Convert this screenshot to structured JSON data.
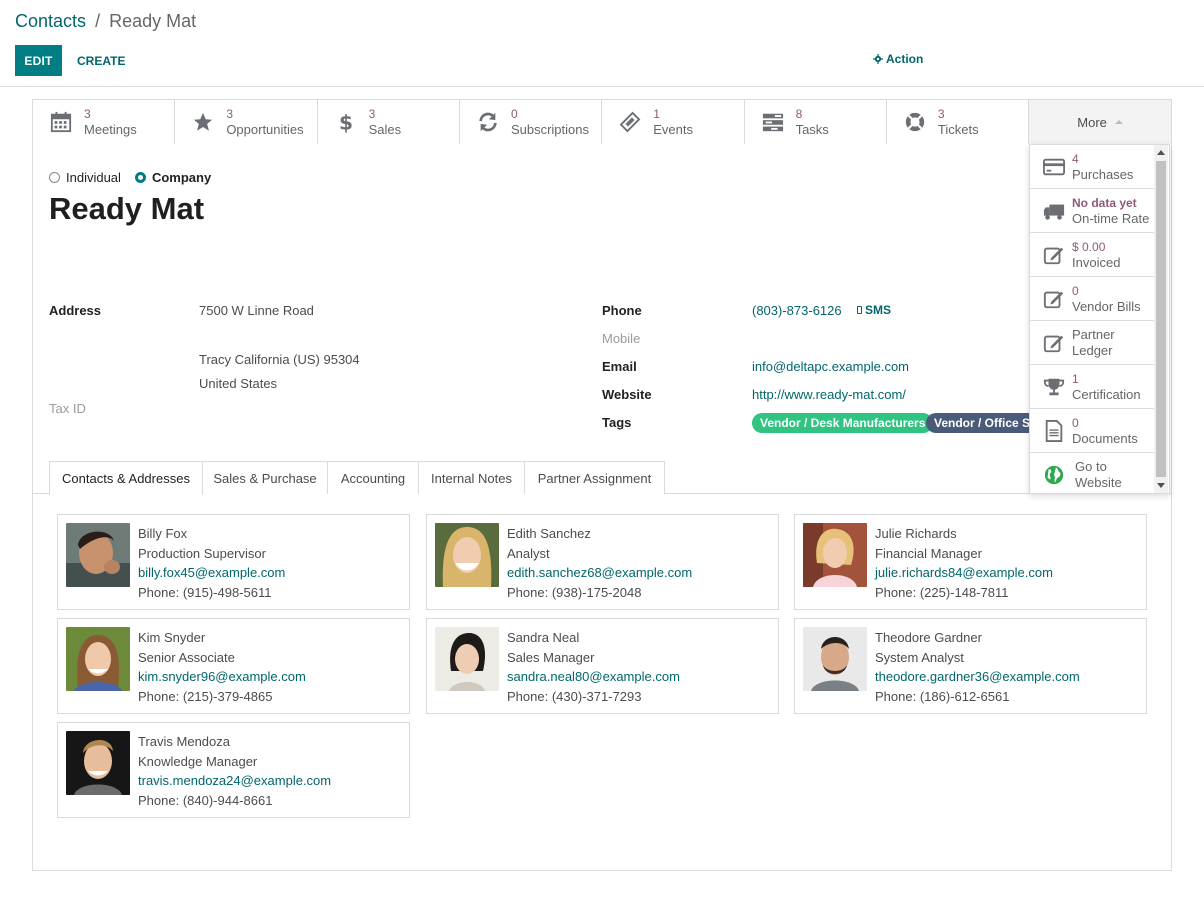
{
  "breadcrumb": {
    "parent": "Contacts",
    "separator": "/",
    "current": "Ready Mat"
  },
  "toolbar": {
    "edit_label": "EDIT",
    "create_label": "CREATE",
    "action_label": "Action"
  },
  "stat_buttons": [
    {
      "value": "3",
      "label": "Meetings",
      "icon": "calendar-icon"
    },
    {
      "value": "3",
      "label": "Opportunities",
      "icon": "star-icon"
    },
    {
      "value": "3",
      "label": "Sales",
      "icon": "dollar-icon"
    },
    {
      "value": "0",
      "label": "Subscriptions",
      "icon": "refresh-icon"
    },
    {
      "value": "1",
      "label": "Events",
      "icon": "ticket-icon"
    },
    {
      "value": "8",
      "label": "Tasks",
      "icon": "tasks-icon"
    },
    {
      "value": "3",
      "label": "Tickets",
      "icon": "lifebuoy-icon"
    }
  ],
  "more_label": "More",
  "more_menu": [
    {
      "value": "4",
      "label": "Purchases",
      "icon": "credit-card-icon"
    },
    {
      "value": "No data yet",
      "label": "On-time Rate",
      "icon": "truck-icon"
    },
    {
      "value": "$ 0.00",
      "label": "Invoiced",
      "icon": "edit-icon"
    },
    {
      "value": "0",
      "label": "Vendor Bills",
      "icon": "edit-icon"
    },
    {
      "label": "Partner",
      "label2": "Ledger",
      "icon": "edit-icon"
    },
    {
      "value": "1",
      "label": "Certification",
      "icon": "trophy-icon"
    },
    {
      "value": "0",
      "label": "Documents",
      "icon": "document-icon"
    },
    {
      "label": "Go to",
      "label2": "Website",
      "icon": "globe-icon"
    }
  ],
  "company_type": {
    "individual": "Individual",
    "company": "Company",
    "selected": "company"
  },
  "partner_name": "Ready Mat",
  "address": {
    "label": "Address",
    "street": "7500 W Linne Road",
    "city_line": "Tracy  California (US)  95304",
    "country": "United States",
    "tax_id_label": "Tax ID"
  },
  "contact_fields": {
    "phone_label": "Phone",
    "phone": "(803)-873-6126",
    "sms_label": "SMS",
    "mobile_label": "Mobile",
    "email_label": "Email",
    "email": "info@deltapc.example.com",
    "website_label": "Website",
    "website": "http://www.ready-mat.com/",
    "tags_label": "Tags"
  },
  "tags": [
    {
      "label": "Vendor / Desk Manufacturers",
      "color": "#30c381"
    },
    {
      "label": "Vendor / Office Supplies",
      "color": "#4a5b7a"
    }
  ],
  "tabs": [
    {
      "label": "Contacts & Addresses",
      "active": true
    },
    {
      "label": "Sales & Purchase",
      "active": false
    },
    {
      "label": "Accounting",
      "active": false
    },
    {
      "label": "Internal Notes",
      "active": false
    },
    {
      "label": "Partner Assignment",
      "active": false
    }
  ],
  "contacts": [
    {
      "name": "Billy Fox",
      "role": "Production Supervisor",
      "email": "billy.fox45@example.com",
      "phone": "Phone: (915)-498-5611"
    },
    {
      "name": "Edith Sanchez",
      "role": "Analyst",
      "email": "edith.sanchez68@example.com",
      "phone": "Phone: (938)-175-2048"
    },
    {
      "name": "Julie Richards",
      "role": "Financial Manager",
      "email": "julie.richards84@example.com",
      "phone": "Phone: (225)-148-7811"
    },
    {
      "name": "Kim Snyder",
      "role": "Senior Associate",
      "email": "kim.snyder96@example.com",
      "phone": "Phone: (215)-379-4865"
    },
    {
      "name": "Sandra Neal",
      "role": "Sales Manager",
      "email": "sandra.neal80@example.com",
      "phone": "Phone: (430)-371-7293"
    },
    {
      "name": "Theodore Gardner",
      "role": "System Analyst",
      "email": "theodore.gardner36@example.com",
      "phone": "Phone: (186)-612-6561"
    },
    {
      "name": "Travis Mendoza",
      "role": "Knowledge Manager",
      "email": "travis.mendoza24@example.com",
      "phone": "Phone: (840)-944-8661"
    }
  ],
  "colors": {
    "primary": "#017e84",
    "link": "#01666b",
    "stat_value": "#8f5978"
  }
}
